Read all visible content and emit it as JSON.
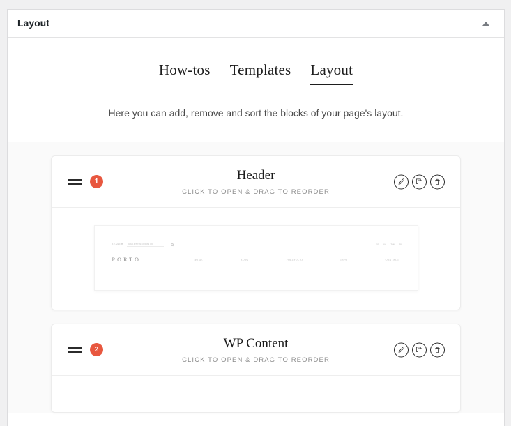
{
  "panel": {
    "title": "Layout",
    "toggle_icon": "caret-up-icon"
  },
  "tabs": [
    {
      "label": "How-tos",
      "active": false
    },
    {
      "label": "Templates",
      "active": false
    },
    {
      "label": "Layout",
      "active": true
    }
  ],
  "intro": {
    "description": "Here you can add, remove and sort the blocks of your page's layout."
  },
  "blocks": [
    {
      "index": "1",
      "name": "Header",
      "hint": "CLICK TO OPEN & DRAG TO REORDER",
      "actions": {
        "edit": "edit-pencil-icon",
        "duplicate": "duplicate-icon",
        "delete": "trash-icon"
      },
      "preview": {
        "search_label": "SEARCH",
        "search_placeholder": "what are you looking for",
        "search_icon": "magnifier-icon",
        "socials": [
          "FB",
          "IN",
          "TW",
          "PI"
        ],
        "logo": "PORTO",
        "nav": [
          "HOME",
          "BLOG",
          "PORTFOLIO",
          "INFO",
          "CONTACT"
        ]
      }
    },
    {
      "index": "2",
      "name": "WP Content",
      "hint": "CLICK TO OPEN & DRAG TO REORDER",
      "actions": {
        "edit": "edit-pencil-icon",
        "duplicate": "duplicate-icon",
        "delete": "trash-icon"
      }
    }
  ],
  "colors": {
    "badge": "#e8573f",
    "panel_bg": "#ffffff",
    "page_bg": "#f0f0f1",
    "blocks_bg": "#fafafa"
  }
}
